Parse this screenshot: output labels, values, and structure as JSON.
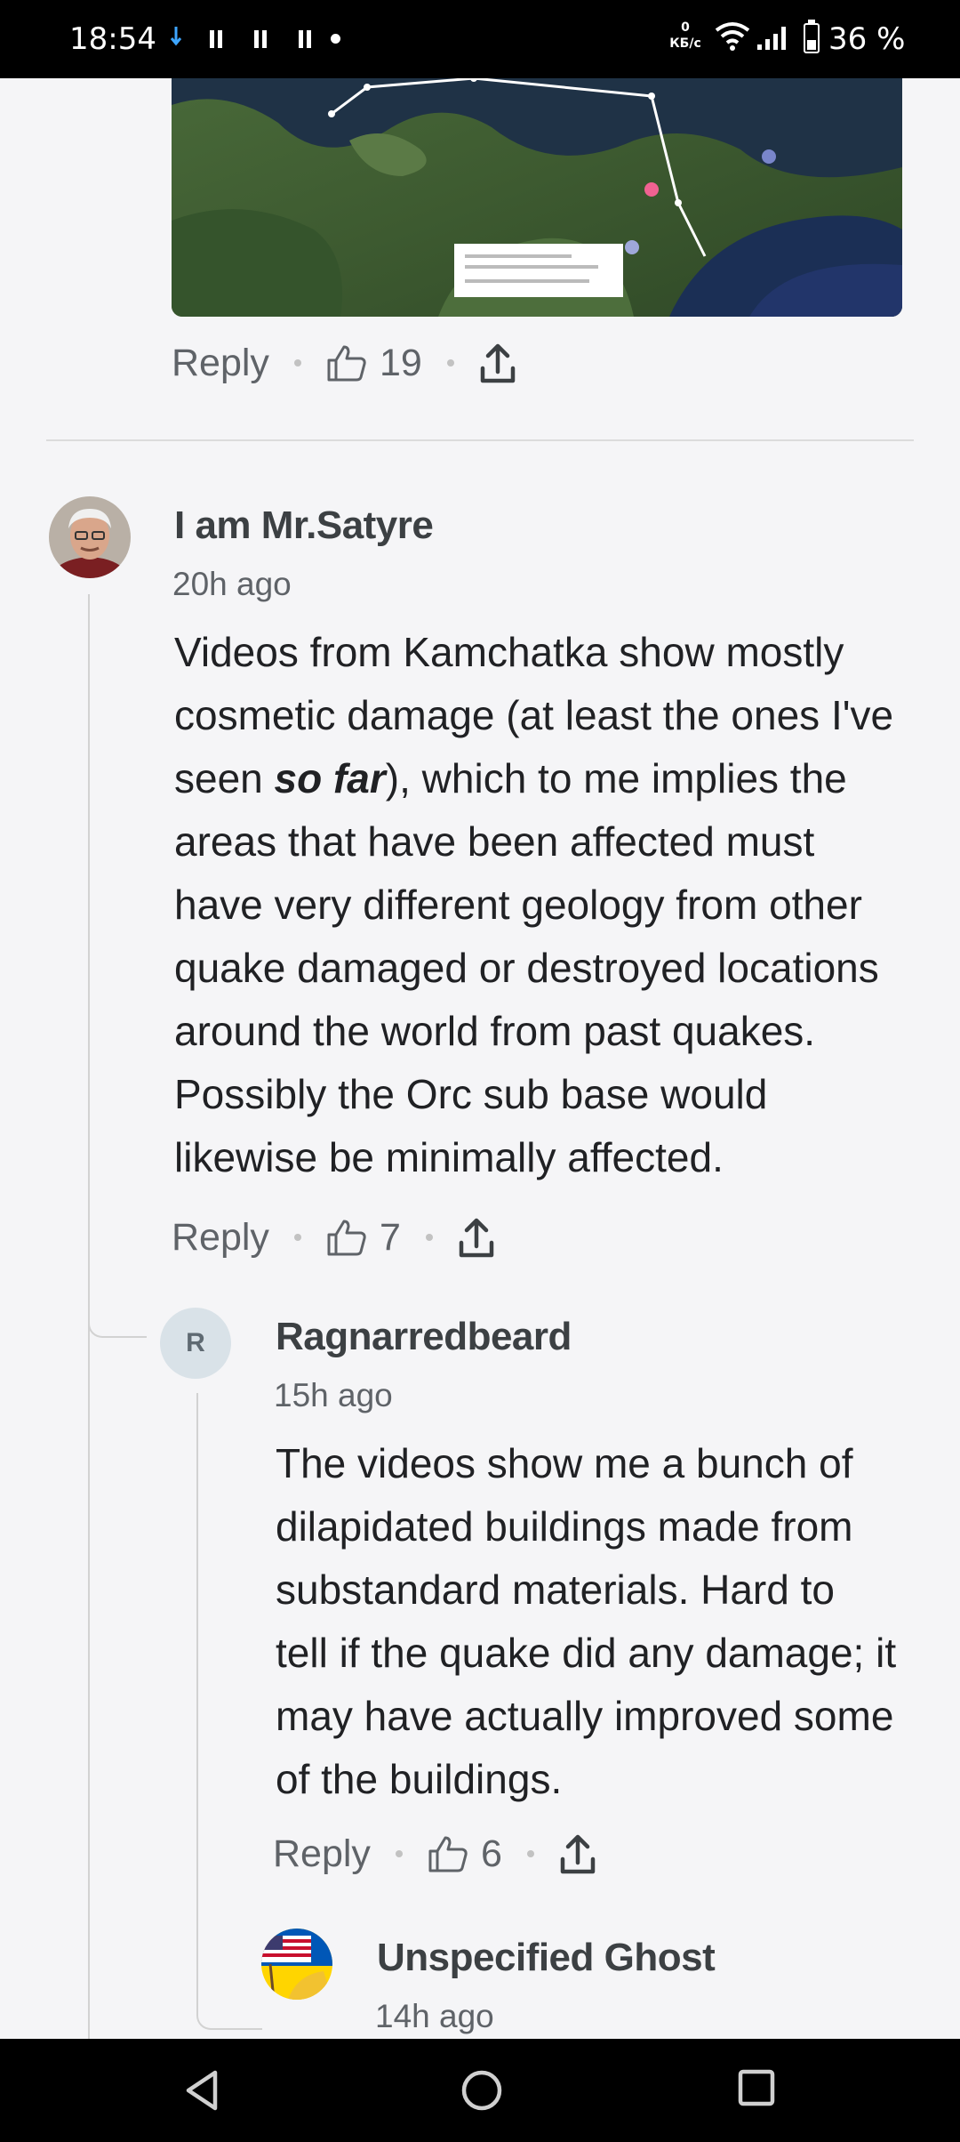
{
  "status_bar": {
    "time": "18:54",
    "net_speed_value": "0",
    "net_speed_unit": "КБ/с",
    "battery": "36 %",
    "battery_level": 0.36,
    "icons": [
      "download-arrow-icon",
      "pause-icon",
      "pause-icon",
      "pause-icon",
      "dot-icon",
      "wifi-icon",
      "signal-icon",
      "battery-icon"
    ]
  },
  "top_comment": {
    "reply_label": "Reply",
    "likes": "19"
  },
  "comments": [
    {
      "author": "I am Mr.Satyre",
      "time": "20h ago",
      "body_before": "Videos from Kamchatka show mostly cosmetic damage (at least the ones I've seen ",
      "body_emphasis": "so far",
      "body_after": "), which to me implies the areas that have been affected must have very different geology from other quake damaged or destroyed locations around the world from past quakes. Possibly the Orc sub base would likewise be minimally affected.",
      "reply_label": "Reply",
      "likes": "7"
    },
    {
      "author": "Ragnarredbeard",
      "avatar_letter": "R",
      "time": "15h ago",
      "body": "The videos show me a bunch of dilapidated buildings made from substandard materials.  Hard to tell if the quake did any damage; it may have actually improved some of the buildings.",
      "reply_label": "Reply",
      "likes": "6"
    },
    {
      "author": "Unspecified Ghost",
      "time": "14h ago"
    }
  ],
  "colors": {
    "background": "#f5f5f7",
    "author": "#3c4043",
    "meta": "#5f6368",
    "thread_line": "#d2d2d2"
  }
}
